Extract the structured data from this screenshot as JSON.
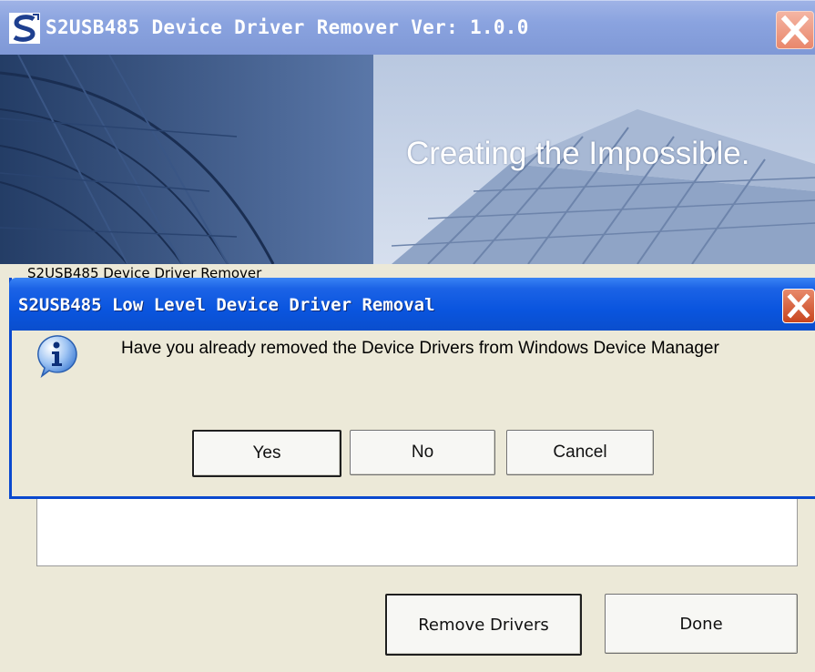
{
  "main_window": {
    "title": "S2USB485 Device Driver Remover Ver: 1.0.0",
    "logo_icon": "s-logo-icon",
    "close_icon": "close-icon",
    "banner": {
      "slogan": "Creating the Impossible."
    },
    "partial_label": "S2USB485 Device Driver Remover",
    "buttons": {
      "remove_drivers": "Remove Drivers",
      "done": "Done"
    }
  },
  "dialog": {
    "title": "S2USB485 Low Level Device Driver Removal",
    "icon": "info-icon",
    "message": "Have you already removed the Device Drivers from Windows Device Manager",
    "buttons": {
      "yes": "Yes",
      "no": "No",
      "cancel": "Cancel"
    }
  },
  "colors": {
    "main_titlebar": "#8aa3df",
    "dialog_titlebar": "#0a55df",
    "dialog_border": "#0a49cf",
    "window_face": "#ece9d8"
  }
}
